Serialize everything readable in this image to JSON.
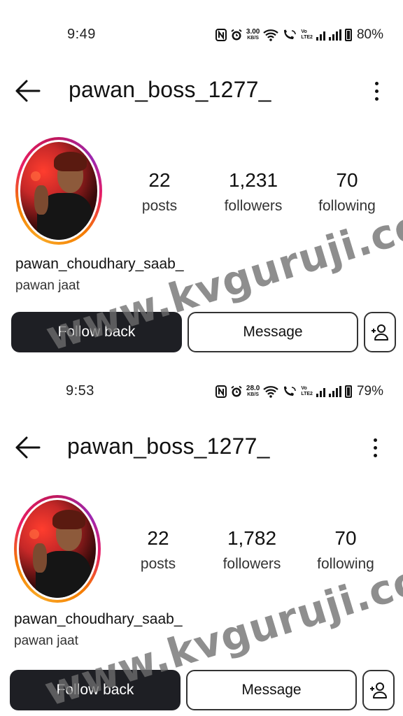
{
  "screens": [
    {
      "status": {
        "time": "9:49",
        "speed_value": "3.00",
        "speed_unit": "KB/S",
        "volte_top": "Vo",
        "volte_bottom": "LTE2",
        "battery": "80%"
      },
      "header": {
        "username": "pawan_boss_1277_"
      },
      "stats": {
        "posts_count": "22",
        "posts_label": "posts",
        "followers_count": "1,231",
        "followers_label": "followers",
        "following_count": "70",
        "following_label": "following"
      },
      "profile": {
        "display_name": "pawan_choudhary_saab_",
        "bio": "pawan jaat"
      },
      "actions": {
        "follow_back_label": "Follow back",
        "message_label": "Message"
      },
      "watermark": "www.kvguruji.com"
    },
    {
      "status": {
        "time": "9:53",
        "speed_value": "28.0",
        "speed_unit": "KB/S",
        "volte_top": "Vo",
        "volte_bottom": "LTE2",
        "battery": "79%"
      },
      "header": {
        "username": "pawan_boss_1277_"
      },
      "stats": {
        "posts_count": "22",
        "posts_label": "posts",
        "followers_count": "1,782",
        "followers_label": "followers",
        "following_count": "70",
        "following_label": "following"
      },
      "profile": {
        "display_name": "pawan_choudhary_saab_",
        "bio": "pawan jaat"
      },
      "actions": {
        "follow_back_label": "Follow back",
        "message_label": "Message"
      },
      "watermark": "www.kvguruji.com"
    }
  ],
  "icons": {
    "back": "arrow-left-icon",
    "more": "kebab-menu-icon",
    "add_user": "add-person-icon",
    "nfc": "nfc-icon",
    "alarm": "alarm-icon",
    "wifi": "wifi-icon",
    "call": "wifi-calling-icon",
    "signal": "cell-signal-icon",
    "battery": "battery-icon"
  },
  "colors": {
    "follow_button_bg": "#1e1f24",
    "follow_button_text": "#ffffff",
    "ring_gradient": [
      "#f9a825",
      "#e91e63",
      "#9c27b0"
    ]
  }
}
